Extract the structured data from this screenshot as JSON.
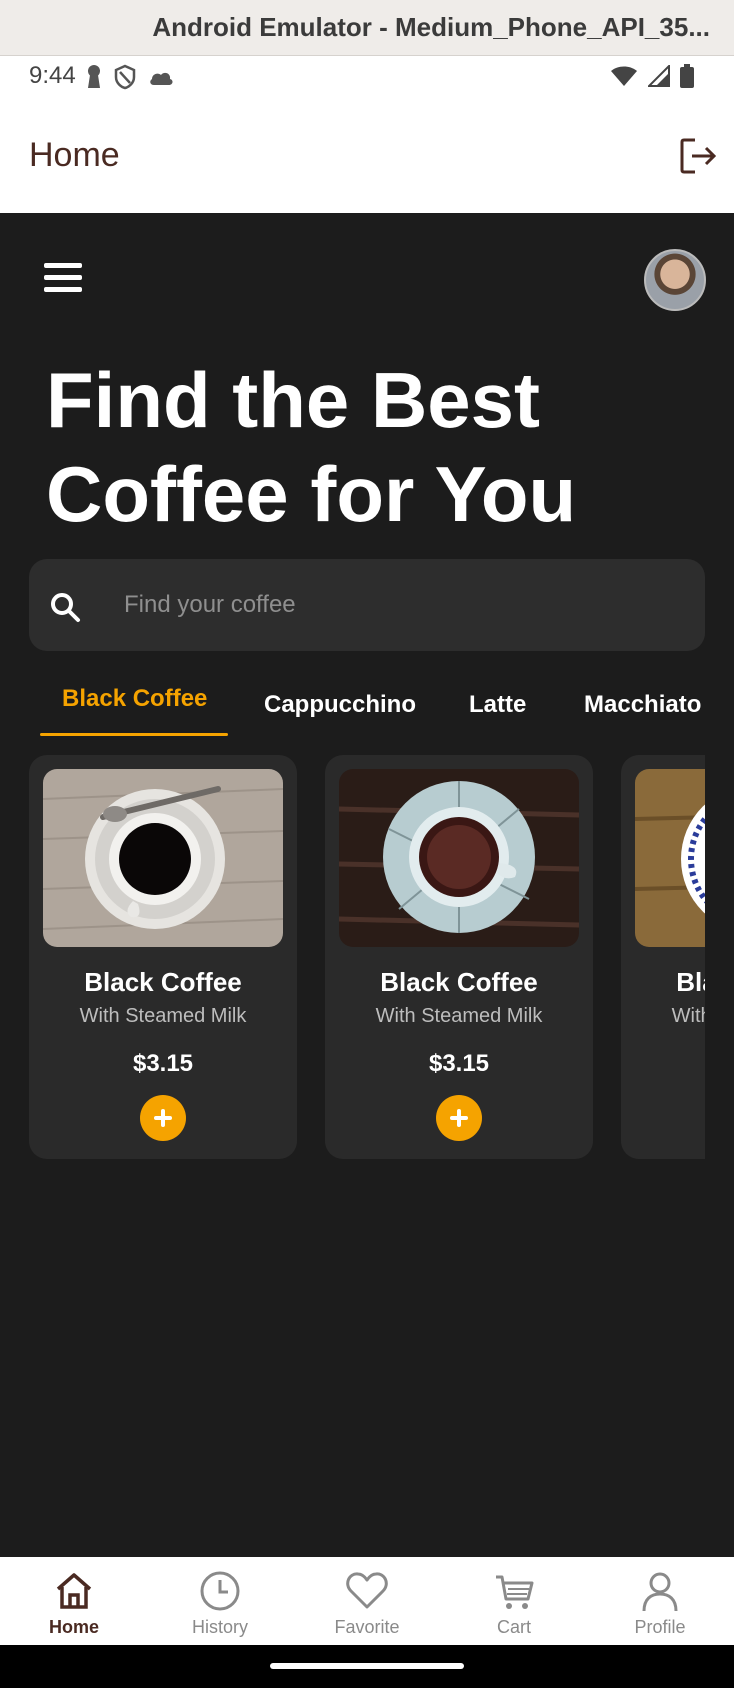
{
  "emulator": {
    "title": "Android Emulator - Medium_Phone_API_35..."
  },
  "status_bar": {
    "time": "9:44"
  },
  "app_bar": {
    "title": "Home"
  },
  "hero": {
    "headline": "Find the Best Coffee for You"
  },
  "search": {
    "placeholder": "Find your coffee"
  },
  "tabs": [
    {
      "label": "Black Coffee",
      "active": true
    },
    {
      "label": "Cappucchino",
      "active": false
    },
    {
      "label": "Latte",
      "active": false
    },
    {
      "label": "Macchiato",
      "active": false
    }
  ],
  "products": [
    {
      "name": "Black Coffee",
      "subtitle": "With Steamed Milk",
      "price": "$3.15"
    },
    {
      "name": "Black Coffee",
      "subtitle": "With Steamed Milk",
      "price": "$3.15"
    },
    {
      "name": "Black Coffee",
      "subtitle": "With Steamed Milk",
      "price": ""
    }
  ],
  "bottom_nav": [
    {
      "label": "Home",
      "icon": "home-icon",
      "active": true
    },
    {
      "label": "History",
      "icon": "clock-icon",
      "active": false
    },
    {
      "label": "Favorite",
      "icon": "heart-icon",
      "active": false
    },
    {
      "label": "Cart",
      "icon": "cart-icon",
      "active": false
    },
    {
      "label": "Profile",
      "icon": "person-icon",
      "active": false
    }
  ],
  "colors": {
    "accent": "#f5a300",
    "background": "#1c1c1c",
    "card": "#2a2a2a",
    "brand_text": "#4a2a22"
  }
}
